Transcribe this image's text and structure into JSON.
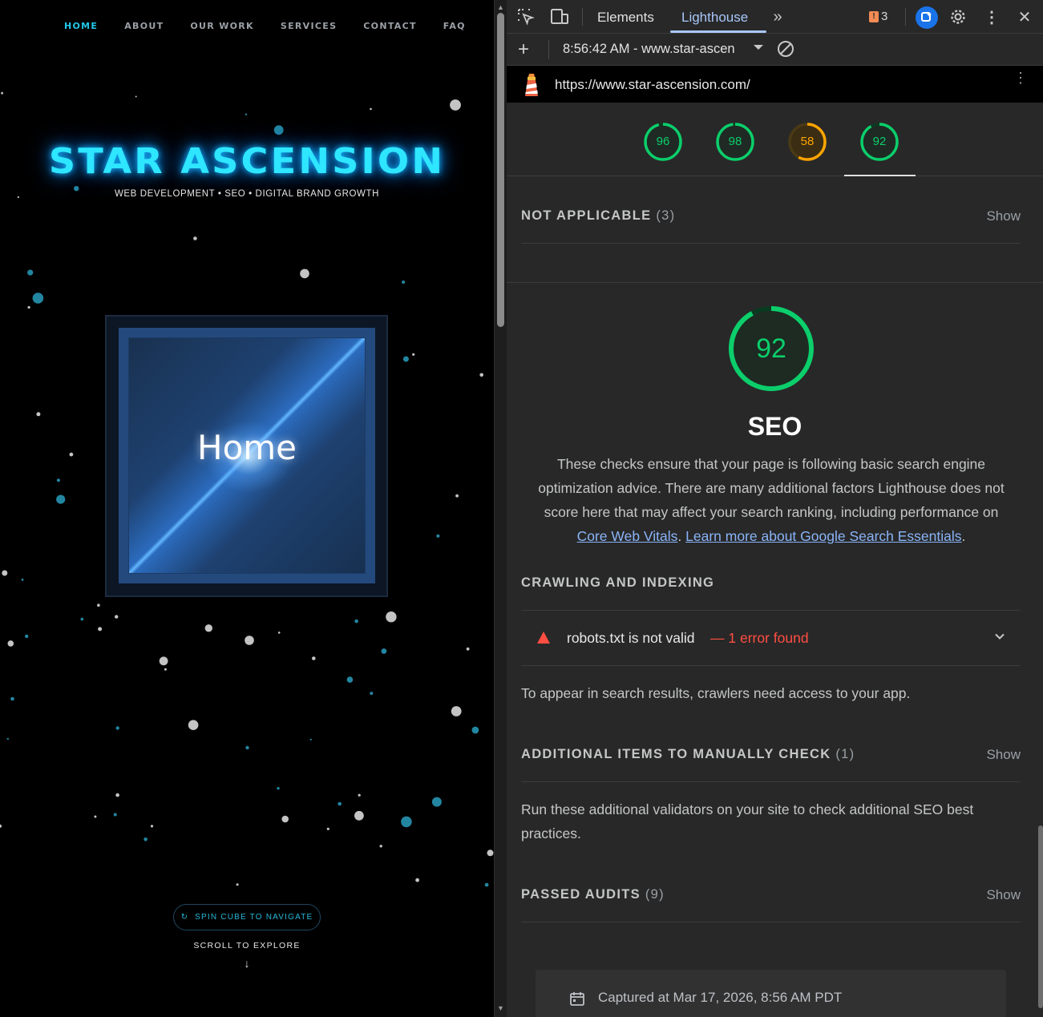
{
  "site": {
    "nav": [
      "HOME",
      "ABOUT",
      "OUR WORK",
      "SERVICES",
      "CONTACT",
      "FAQ"
    ],
    "brand_title": "STAR ASCENSION",
    "brand_tagline": "WEB DEVELOPMENT • SEO • DIGITAL BRAND GROWTH",
    "cube_label": "Home",
    "spin_button": "SPIN CUBE TO NAVIGATE",
    "scroll_hint": "SCROLL TO EXPLORE",
    "scroll_arrow": "↓"
  },
  "devtools": {
    "tabs": [
      "Elements",
      "Lighthouse"
    ],
    "active_tab": "Lighthouse",
    "issues_count": "3",
    "report_selector": "8:56:42 AM - www.star-ascen",
    "url": "https://www.star-ascension.com/",
    "category_scores": [
      {
        "value": "96",
        "color": "#0cce6b"
      },
      {
        "value": "98",
        "color": "#0cce6b"
      },
      {
        "value": "58",
        "color": "#ffa400"
      },
      {
        "value": "92",
        "color": "#0cce6b"
      }
    ],
    "not_applicable": {
      "label": "NOT APPLICABLE",
      "count": "(3)",
      "action": "Show"
    },
    "seo": {
      "score": "92",
      "title": "SEO",
      "description": "These checks ensure that your page is following basic search engine optimization advice. There are many additional factors Lighthouse does not score here that may affect your search ranking, including performance on",
      "link1": "Core Web Vitals",
      "link2": "Learn more about Google Search Essentials"
    },
    "crawling": {
      "label": "CRAWLING AND INDEXING",
      "audit_title": "robots.txt is not valid",
      "audit_error": "— 1 error found",
      "note": "To appear in search results, crawlers need access to your app."
    },
    "manual": {
      "label": "ADDITIONAL ITEMS TO MANUALLY CHECK",
      "count": "(1)",
      "action": "Show",
      "text": "Run these additional validators on your site to check additional SEO best practices."
    },
    "passed": {
      "label": "PASSED AUDITS",
      "count": "(9)",
      "action": "Show"
    },
    "captured": "Captured at Mar 17, 2026, 8:56 AM PDT"
  },
  "colors": {
    "pass": "#0cce6b",
    "average": "#ffa400",
    "fail": "#ff4e42",
    "accent": "#a8c7fa",
    "brand": "#2ee6ff"
  }
}
